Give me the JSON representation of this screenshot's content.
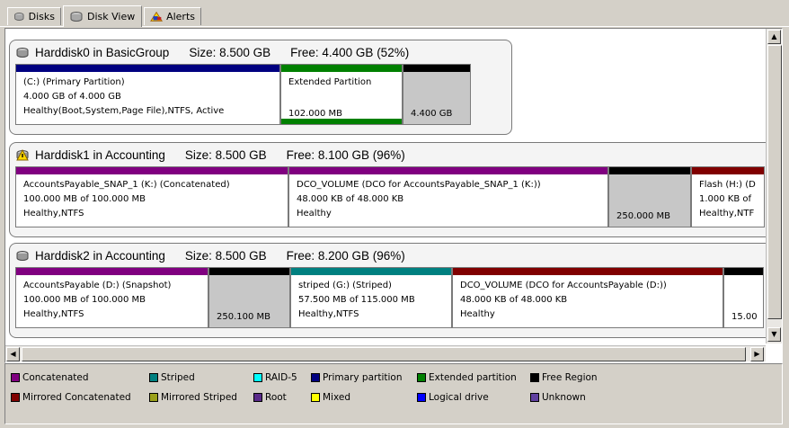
{
  "tabs": [
    {
      "label": "Disks",
      "icon": "disks-icon"
    },
    {
      "label": "Disk View",
      "icon": "disk-view-icon"
    },
    {
      "label": "Alerts",
      "icon": "alerts-icon"
    }
  ],
  "disks": [
    {
      "name": "Harddisk0 in BasicGroup",
      "size": "Size: 8.500 GB",
      "free": "Free: 4.400 GB (52%)",
      "icon": "harddisk-icon",
      "partitions": [
        {
          "lines": [
            "(C:) (Primary Partition)",
            "4.000 GB of 4.000 GB",
            "Healthy(Boot,System,Page File),NTFS, Active"
          ],
          "color": "#000080"
        },
        {
          "lines": [
            "Extended Partition"
          ],
          "size": "102.000 MB",
          "color": "#008000"
        },
        {
          "size": "4.400 GB",
          "color": "#000000"
        }
      ]
    },
    {
      "name": "Harddisk1 in Accounting",
      "size": "Size: 8.500 GB",
      "free": "Free: 8.100 GB (96%)",
      "icon": "harddisk-alert-icon",
      "partitions": [
        {
          "lines": [
            "AccountsPayable_SNAP_1 (K:) (Concatenated)",
            "100.000 MB of 100.000 MB",
            "Healthy,NTFS"
          ],
          "color": "#800080"
        },
        {
          "lines": [
            "DCO_VOLUME (DCO for AccountsPayable_SNAP_1 (K:))",
            "48.000 KB of 48.000 KB",
            "Healthy"
          ],
          "color": "#800080"
        },
        {
          "size": "250.000 MB",
          "color": "#000000"
        },
        {
          "lines": [
            "Flash (H:) (D",
            "1.000 KB of",
            "Healthy,NTF"
          ],
          "color": "#800000"
        }
      ]
    },
    {
      "name": "Harddisk2 in Accounting",
      "size": "Size: 8.500 GB",
      "free": "Free: 8.200 GB (96%)",
      "icon": "harddisk-icon",
      "partitions": [
        {
          "lines": [
            "AccountsPayable (D:) (Snapshot)",
            "100.000 MB of 100.000 MB",
            "Healthy,NTFS"
          ],
          "color": "#800080"
        },
        {
          "size": "250.100 MB",
          "color": "#000000"
        },
        {
          "lines": [
            "striped (G:) (Striped)",
            "57.500 MB of 115.000 MB",
            "Healthy,NTFS"
          ],
          "color": "#008080"
        },
        {
          "lines": [
            "DCO_VOLUME (DCO for AccountsPayable (D:))",
            "48.000 KB of 48.000 KB",
            "Healthy"
          ],
          "color": "#800000"
        },
        {
          "size": "15.00",
          "color": "#000000"
        }
      ]
    }
  ],
  "legend": [
    {
      "label": "Concatenated",
      "color": "#800080"
    },
    {
      "label": "Striped",
      "color": "#008080"
    },
    {
      "label": "RAID-5",
      "color": "#00ffff"
    },
    {
      "label": "Primary partition",
      "color": "#000080"
    },
    {
      "label": "Extended partition",
      "color": "#008000"
    },
    {
      "label": "Free Region",
      "color": "#000000"
    },
    {
      "label": "Mirrored Concatenated",
      "color": "#800000"
    },
    {
      "label": "Mirrored Striped",
      "color": "#9aa01a"
    },
    {
      "label": "Root",
      "color": "#5a2a8a"
    },
    {
      "label": "Mixed",
      "color": "#ffff00"
    },
    {
      "label": "Logical drive",
      "color": "#0000ff"
    },
    {
      "label": "Unknown",
      "color": "#6040a0"
    }
  ]
}
